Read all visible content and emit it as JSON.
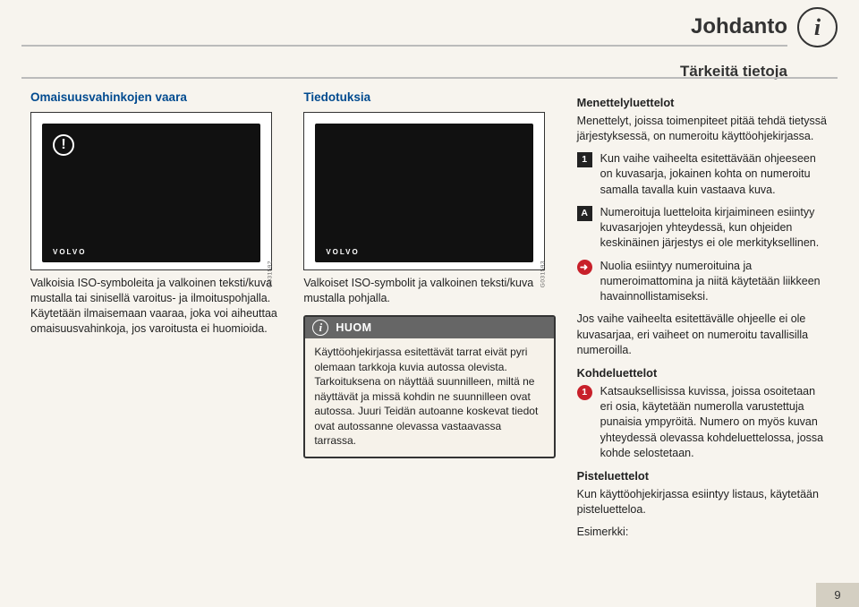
{
  "header": {
    "title": "Johdanto",
    "breadcrumb": "Tärkeitä tietoja",
    "info_icon_glyph": "i"
  },
  "page_number": "9",
  "col1": {
    "heading": "Omaisuusvahinkojen vaara",
    "image_code": "G031592",
    "image_logo": "VOLVO",
    "warning_glyph": "!",
    "caption": "Valkoisia ISO-symboleita ja valkoinen teksti/kuva mustalla tai sinisellä varoitus- ja ilmoituspohjalla. Käytetään ilmaisemaan vaaraa, joka voi aiheuttaa omaisuusvahinkoja, jos varoitusta ei huomioida."
  },
  "col2": {
    "heading": "Tiedotuksia",
    "image_code": "G031593",
    "image_logo": "VOLVO",
    "caption": "Valkoiset ISO-symbolit ja valkoinen teksti/kuva mustalla pohjalla.",
    "note": {
      "label": "HUOM",
      "icon_glyph": "i",
      "body": "Käyttöohjekirjassa esitettävät tarrat eivät pyri olemaan tarkkoja kuvia autossa olevista. Tarkoituksena on näyttää suunnilleen, miltä ne näyttävät ja missä kohdin ne suunnilleen ovat autossa. Juuri Teidän autoanne koskevat tiedot ovat autossanne olevassa vastaavassa tarrassa."
    }
  },
  "col3": {
    "heading": "Menettelyluettelot",
    "intro": "Menettelyt, joissa toimenpiteet pitää tehdä tietyssä järjestyksessä, on numeroitu käyttöohjekirjassa.",
    "items": [
      {
        "badge": "1",
        "style": "square",
        "text": "Kun vaihe vaiheelta esitettävään ohjeeseen on kuvasarja, jokainen kohta on numeroitu samalla tavalla kuin vastaava kuva."
      },
      {
        "badge": "A",
        "style": "square",
        "text": "Numeroituja luetteloita kirjaimineen esiintyy kuvasarjojen yhteydessä, kun ohjeiden keskinäinen järjestys ei ole merkityksellinen."
      },
      {
        "badge": "arrow",
        "style": "arrow",
        "text": "Nuolia esiintyy numeroituina ja numeroimattomina ja niitä käytetään liikkeen havainnollistamiseksi."
      }
    ],
    "para_after": "Jos vaihe vaiheelta esitettävälle ohjeelle ei ole kuvasarjaa, eri vaiheet on numeroitu tavallisilla numeroilla.",
    "kohde_heading": "Kohdeluettelot",
    "kohde_item": {
      "badge": "1",
      "text": "Katsauksellisissa kuvissa, joissa osoitetaan eri osia, käytetään numerolla varustettuja punaisia ympyröitä. Numero on myös kuvan yhteydessä olevassa kohdeluettelossa, jossa kohde selostetaan."
    },
    "piste_heading": "Pisteluettelot",
    "piste_para": "Kun käyttöohjekirjassa esiintyy listaus, käytetään pisteluetteloa.",
    "piste_example_label": "Esimerkki:"
  }
}
